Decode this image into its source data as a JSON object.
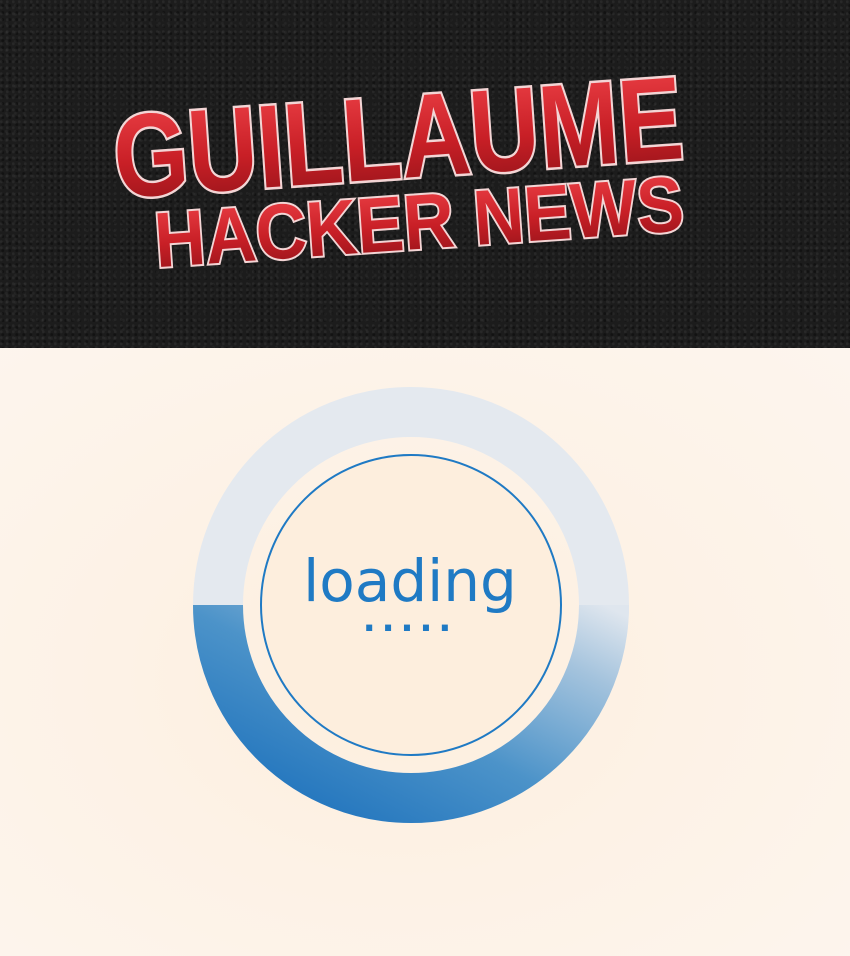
{
  "header": {
    "logo": {
      "line1": "GUILLAUME",
      "line2": "HACKER NEWS"
    },
    "background_color": "#1c1c1c"
  },
  "loader": {
    "text": "loading",
    "dots": ".....",
    "accent_color": "#1f7ac4",
    "track_color": "#e3e8ee",
    "progress": 0.5
  },
  "colors": {
    "logo_red": "#d0262b",
    "page_background": "#fdf2e6"
  }
}
